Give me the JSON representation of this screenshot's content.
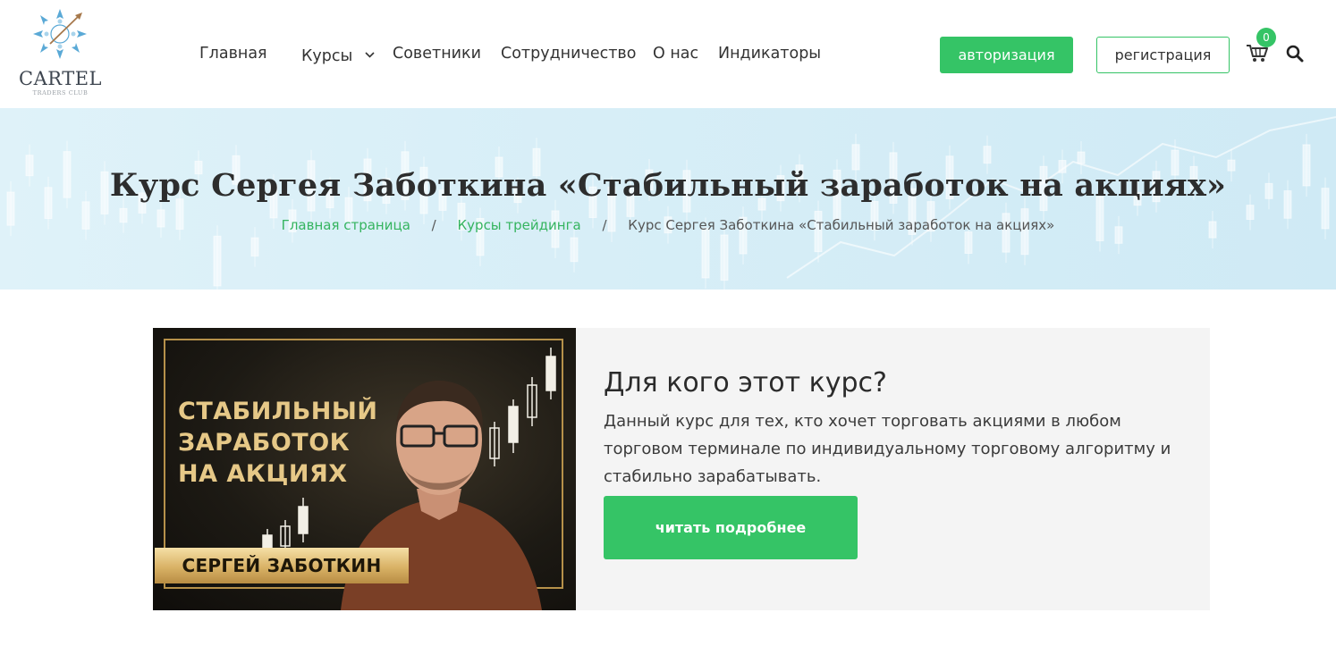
{
  "logo": {
    "title": "CARTEL",
    "subtitle": "TRADERS CLUB"
  },
  "nav": {
    "items": [
      {
        "label": "Главная"
      },
      {
        "label": "Курсы"
      },
      {
        "label": "Советники"
      },
      {
        "label": "Сотрудничество"
      },
      {
        "label": "О нас"
      },
      {
        "label": "Индикаторы"
      }
    ]
  },
  "header": {
    "auth_label": "авторизация",
    "register_label": "регистрация",
    "cart_count": "0",
    "icons": [
      "cart-icon",
      "search-icon",
      "chevron-down-icon"
    ]
  },
  "hero": {
    "title": "Курс Сергея Заботкина «Стабильный заработок на акциях»",
    "breadcrumb": [
      {
        "label": "Главная страница"
      },
      {
        "label": "Курсы трейдинга"
      },
      {
        "label": "Курс Сергея Заботкина «Стабильный заработок на акциях»"
      }
    ],
    "separator": "/"
  },
  "course": {
    "banner": {
      "line1": "СТАБИЛЬНЫЙ",
      "line2": "ЗАРАБОТОК",
      "line3": "НА АКЦИЯХ",
      "author": "СЕРГЕЙ ЗАБОТКИН"
    },
    "heading": "Для кого этот курс?",
    "description": "Данный курс для тех, кто хочет торговать акциями в любом торговом терминале по индивидуальному торговому алгоритму и стабильно зарабатывать.",
    "more_label": "читать подробнее"
  },
  "colors": {
    "accent": "#35c466",
    "link": "#35b45f",
    "hero_bg": "#d7eef7",
    "gold": "#d9b266"
  }
}
